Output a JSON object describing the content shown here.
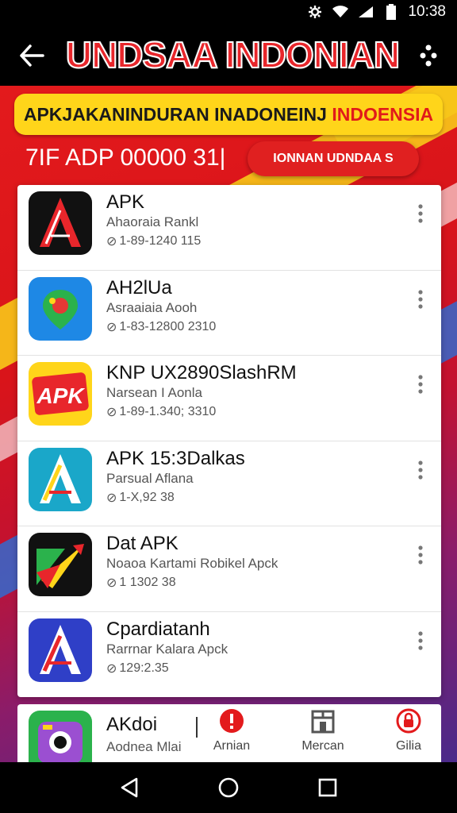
{
  "status_bar": {
    "time": "10:38"
  },
  "header": {
    "title": "UNDSAA INDONIAN"
  },
  "banner": {
    "main_text": "APKJAKANINDURAN INADONEINJ",
    "accent_text": "INDOENSIA"
  },
  "subline": {
    "text": "7IF ADP 00000 31|"
  },
  "cta_button": {
    "label": "IONNAN UDNDAA S"
  },
  "apps": [
    {
      "name": "APK",
      "developer": "Ahaoraia Rankl",
      "meta": "1-89-1240 115",
      "icon": "app-logo-a-dark"
    },
    {
      "name": "AH2lUa",
      "developer": "Asraaiaia Aooh",
      "meta": "1-83-12800 2310",
      "icon": "map-pin-app"
    },
    {
      "name": "KNP UX2890SlashRM",
      "developer": "Narsean I Aonla",
      "meta": "1-89-1.340; 3310",
      "icon": "apk-logo-red"
    },
    {
      "name": "APK 15:3Dalkas",
      "developer": "Parsual Aflana",
      "meta": "1-X,92 38",
      "icon": "app-logo-a-teal"
    },
    {
      "name": "Dat APK",
      "developer": "Noaoa Kartami Robikel Apck",
      "meta": "1 1302 38",
      "icon": "app-logo-arrow"
    },
    {
      "name": "Cpardiatanh",
      "developer": "Rarrnar Kalara Apck",
      "meta": "129:2.35",
      "icon": "app-logo-a-blue"
    }
  ],
  "bottom_card": {
    "name": "AKdoi",
    "developer": "Aodnea Mlai"
  },
  "bottom_nav": [
    {
      "label": "Arnian",
      "icon": "alert-icon"
    },
    {
      "label": "Mercan",
      "icon": "store-icon"
    },
    {
      "label": "Gilia",
      "icon": "lock-icon"
    }
  ],
  "colors": {
    "brand_red": "#e8262b",
    "banner_yellow": "#ffd51a"
  }
}
